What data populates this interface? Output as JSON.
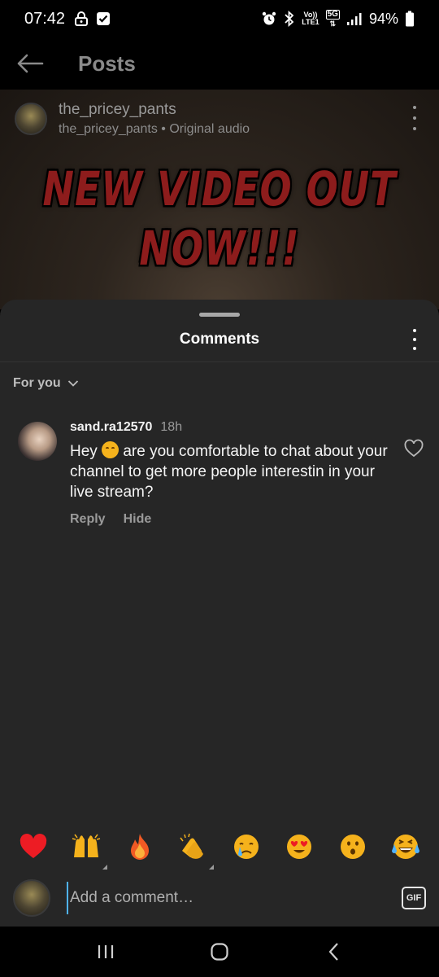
{
  "status": {
    "time": "07:42",
    "battery": "94%",
    "icons": [
      "lock-icon",
      "checkbox-icon",
      "alarm-icon",
      "bluetooth-icon",
      "volte-icon",
      "5g-icon",
      "signal-icon",
      "battery-icon"
    ],
    "network_top": "Vo))",
    "network_bottom": "LTE1",
    "gen": "5G"
  },
  "topnav": {
    "title": "Posts"
  },
  "post": {
    "username": "the_pricey_pants",
    "subtitle": "the_pricey_pants • Original audio",
    "banner_line1": "NEW VIDEO OUT",
    "banner_line2": "NOW!!!"
  },
  "comments_sheet": {
    "title": "Comments",
    "filter_label": "For you",
    "comments": [
      {
        "user": "sand.ra12570",
        "time": "18h",
        "text_before_emoji": "Hey ",
        "text_after_emoji": " are you comfortable to chat about your channel to get more people interestin in your live stream?",
        "reply_label": "Reply",
        "hide_label": "Hide"
      }
    ]
  },
  "reactions": [
    "heart-emoji",
    "raising-hands-emoji",
    "fire-emoji",
    "clapping-emoji",
    "crying-emoji",
    "heart-eyes-emoji",
    "surprised-emoji",
    "laughing-emoji"
  ],
  "add_comment": {
    "placeholder": "Add a comment…",
    "gif_label": "GIF"
  },
  "colors": {
    "sheet_bg": "#262626",
    "banner_red": "#8d1c1c",
    "heart_red": "#ed1c24",
    "cursor_blue": "#4fb3ff"
  }
}
